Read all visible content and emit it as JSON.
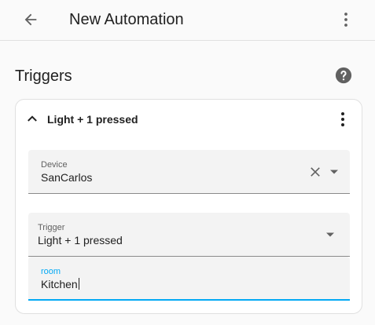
{
  "header": {
    "back_icon": "arrow-left-icon",
    "title": "New Automation",
    "menu_icon": "dots-vertical-icon"
  },
  "triggers": {
    "title": "Triggers",
    "help_icon": "help-circle-icon",
    "card": {
      "title": "Light + 1 pressed",
      "collapse_icon": "chevron-up-icon",
      "menu_icon": "dots-vertical-icon",
      "device": {
        "label": "Device",
        "value": "SanCarlos",
        "clear_icon": "close-icon",
        "dropdown_icon": "menu-down-icon"
      },
      "trigger": {
        "label": "Trigger",
        "value": "Light + 1 pressed",
        "dropdown_icon": "menu-down-icon"
      },
      "room": {
        "label": "room",
        "value": "Kitchen"
      }
    }
  },
  "colors": {
    "accent": "#03a9f4",
    "background": "#fafafa",
    "field_background": "#f3f3f3"
  }
}
